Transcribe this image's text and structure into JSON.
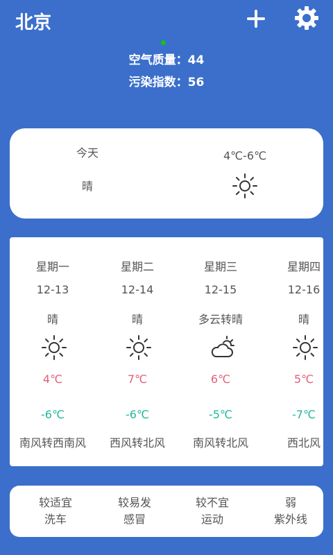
{
  "header": {
    "city": "北京"
  },
  "air": {
    "quality_text": "空气质量：44",
    "pollution_text": "污染指数：56"
  },
  "today": {
    "label": "今天",
    "weather": "晴",
    "temp_range": "4℃-6℃"
  },
  "forecast": [
    {
      "weekday": "星期一",
      "date": "12-13",
      "weather": "晴",
      "icon": "sun-icon",
      "high": "4℃",
      "low": "-6℃",
      "wind": "南风转西南风"
    },
    {
      "weekday": "星期二",
      "date": "12-14",
      "weather": "晴",
      "icon": "sun-icon",
      "high": "7℃",
      "low": "-6℃",
      "wind": "西风转北风"
    },
    {
      "weekday": "星期三",
      "date": "12-15",
      "weather": "多云转晴",
      "icon": "partly-cloudy-icon",
      "high": "6℃",
      "low": "-5℃",
      "wind": "南风转北风"
    },
    {
      "weekday": "星期四",
      "date": "12-16",
      "weather": "晴",
      "icon": "sun-icon",
      "high": "5℃",
      "low": "-7℃",
      "wind": "西北风"
    }
  ],
  "life_index": [
    {
      "level": "较适宜",
      "name": "洗车"
    },
    {
      "level": "较易发",
      "name": "感冒"
    },
    {
      "level": "较不宜",
      "name": "运动"
    },
    {
      "level": "弱",
      "name": "紫外线"
    }
  ],
  "colors": {
    "background": "#3b6fcb",
    "high_temp": "#e0607a",
    "low_temp": "#20b79a",
    "indicator_dot": "#11c411"
  }
}
